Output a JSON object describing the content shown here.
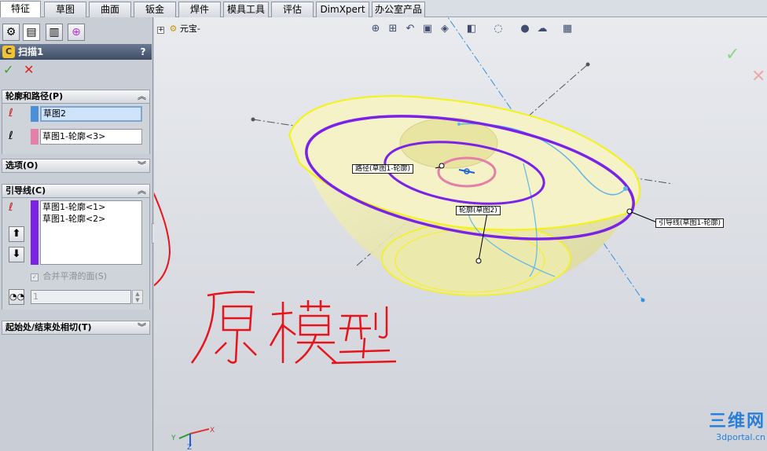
{
  "tabs": [
    {
      "label": "特征",
      "active": true
    },
    {
      "label": "草图"
    },
    {
      "label": "曲面"
    },
    {
      "label": "钣金"
    },
    {
      "label": "焊件"
    },
    {
      "label": "模具工具"
    },
    {
      "label": "评估"
    },
    {
      "label": "DimXpert"
    },
    {
      "label": "办公室产品"
    }
  ],
  "property_manager": {
    "title": "扫描1",
    "help": "?",
    "ok_symbol": "✓",
    "cancel_symbol": "✕",
    "profile_path": {
      "header": "轮廓和路径(P)",
      "profile_value": "草图2",
      "path_value": "草图1-轮廓<3>",
      "profile_color": "#4a90d9",
      "path_color": "#e37fa8"
    },
    "options": {
      "header": "选项(O)"
    },
    "guide_curves": {
      "header": "引导线(C)",
      "items": [
        "草图1-轮廓<1>",
        "草图1-轮廓<2>"
      ],
      "list_color": "#7a22e6",
      "merge_smooth_label": "合并平滑的面(S)",
      "spin_value": "1"
    },
    "start_end_tangency": {
      "header": "起始处/结束处相切(T)"
    }
  },
  "viewport": {
    "tree_root": "元宝-",
    "callouts": {
      "path": "路径(草图1-轮廓)",
      "profile": "轮廓(草图2)",
      "guide": "引导线(草图1-轮廓)"
    },
    "handwritten_note": "原模型",
    "watermark_text": "三维网",
    "watermark_url": "3dportal.cn",
    "triad_axes": {
      "x": "X",
      "y": "Y",
      "z": "Z"
    }
  },
  "colors": {
    "accent_purple": "#7a22e6",
    "model_yellow": "#f2ef9a",
    "highlight_yellow": "#f3f312",
    "guide_cyan": "#5fb6e8",
    "red_annotation": "#e6131a",
    "watermark_blue": "#2b7fd6"
  }
}
